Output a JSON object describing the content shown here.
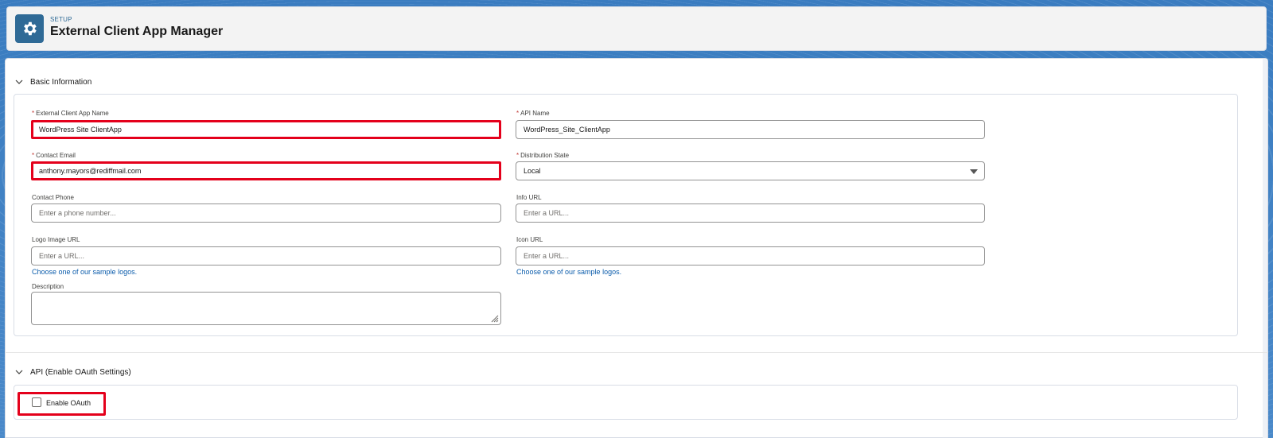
{
  "header": {
    "eyebrow": "SETUP",
    "title": "External Client App Manager",
    "icon": "gear-icon"
  },
  "basic_section": {
    "title": "Basic Information",
    "fields": {
      "app_name": {
        "label": "External Client App Name",
        "required": true,
        "value": "WordPress Site ClientApp"
      },
      "api_name": {
        "label": "API Name",
        "required": true,
        "value": "WordPress_Site_ClientApp"
      },
      "contact_email": {
        "label": "Contact Email",
        "required": true,
        "value": "anthony.mayors@rediffmail.com"
      },
      "distribution_state": {
        "label": "Distribution State",
        "required": true,
        "value": "Local"
      },
      "contact_phone": {
        "label": "Contact Phone",
        "placeholder": "Enter a phone number..."
      },
      "info_url": {
        "label": "Info URL",
        "placeholder": "Enter a URL..."
      },
      "logo_url": {
        "label": "Logo Image URL",
        "placeholder": "Enter a URL...",
        "link": "Choose one of our sample logos."
      },
      "icon_url": {
        "label": "Icon URL",
        "placeholder": "Enter a URL...",
        "link": "Choose one of our sample logos."
      },
      "description": {
        "label": "Description"
      }
    }
  },
  "api_section": {
    "title": "API (Enable OAuth Settings)",
    "enable_oauth_label": "Enable OAuth",
    "enable_oauth_checked": false
  },
  "colors": {
    "highlight": "#e4001b",
    "link": "#0b5cab",
    "required": "#c23934",
    "brand_icon": "#2f6a96"
  }
}
